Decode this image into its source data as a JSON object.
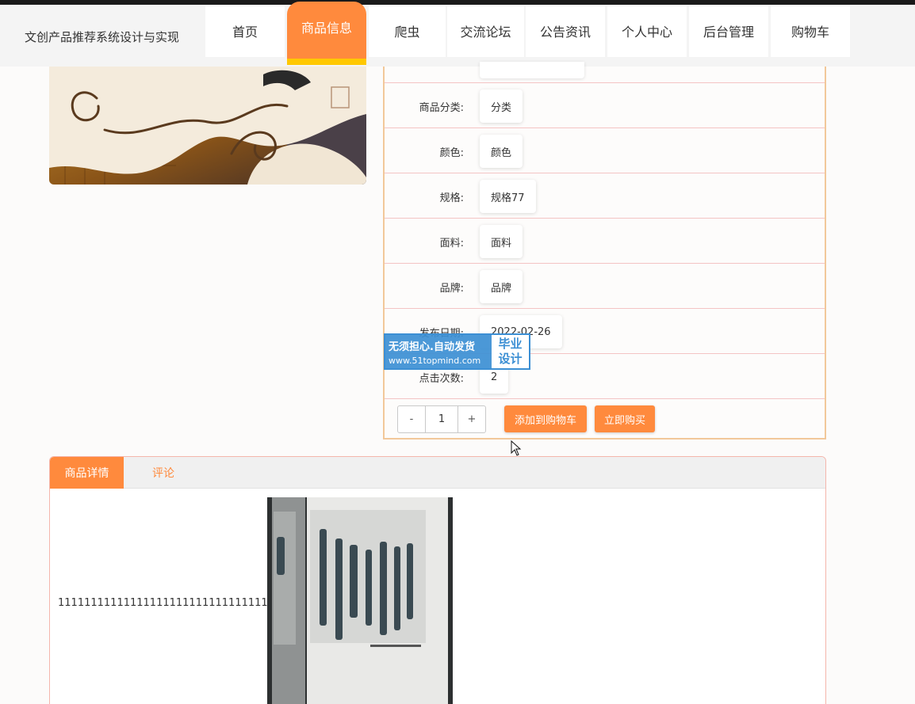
{
  "site": {
    "title": "文创产品推荐系统设计与实现"
  },
  "nav": {
    "items": [
      {
        "label": "首页",
        "active": false
      },
      {
        "label": "商品信息",
        "active": true
      },
      {
        "label": "爬虫",
        "active": false
      },
      {
        "label": "交流论坛",
        "active": false
      },
      {
        "label": "公告资讯",
        "active": false
      },
      {
        "label": "个人中心",
        "active": false
      },
      {
        "label": "后台管理",
        "active": false
      },
      {
        "label": "购物车",
        "active": false
      }
    ]
  },
  "product": {
    "fields": [
      {
        "label": "商品分类:",
        "value": "分类"
      },
      {
        "label": "颜色:",
        "value": "颜色"
      },
      {
        "label": "规格:",
        "value": "规格77"
      },
      {
        "label": "面料:",
        "value": "面料"
      },
      {
        "label": "品牌:",
        "value": "品牌"
      },
      {
        "label": "发布日期:",
        "value": "2022-02-26"
      },
      {
        "label": "点击次数:",
        "value": "2"
      }
    ],
    "quantity": {
      "minus": "-",
      "value": "1",
      "plus": "+"
    },
    "add_to_cart": "添加到购物车",
    "buy_now": "立即购买"
  },
  "watermark": {
    "line1": "无须担心.自动发货",
    "line2": "www.51topmind.com",
    "right_top": "毕业",
    "right_bottom": "设计"
  },
  "tabs": {
    "items": [
      {
        "label": "商品详情",
        "active": true
      },
      {
        "label": "评论",
        "active": false
      }
    ],
    "detail_text": "111111111111111111111111111111111111111"
  },
  "colors": {
    "accent": "#ff8a3d",
    "nav_underline": "#ffc800",
    "watermark_blue": "#3c8fd4",
    "row_border": "#f4c4c4",
    "table_border": "#f2c89a"
  }
}
